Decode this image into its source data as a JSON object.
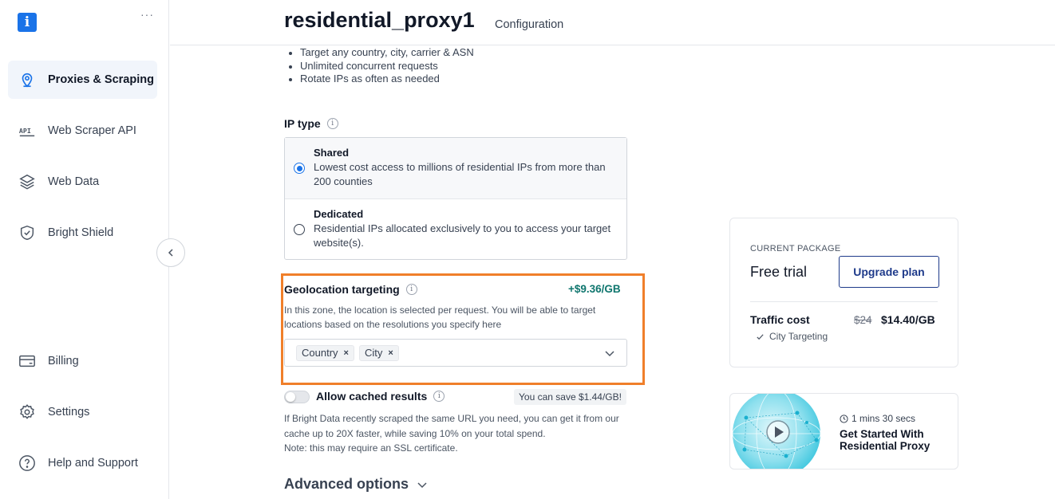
{
  "sidebar": {
    "logo_letter": "i",
    "more": "···",
    "items": [
      {
        "label": "Proxies & Scraping",
        "icon": "location-pin-icon",
        "active": true
      },
      {
        "label": "Web Scraper API",
        "icon": "api-icon",
        "active": false
      },
      {
        "label": "Web Data",
        "icon": "layers-icon",
        "active": false
      },
      {
        "label": "Bright Shield",
        "icon": "shield-icon",
        "active": false
      },
      {
        "label": "Billing",
        "icon": "credit-card-icon",
        "active": false
      },
      {
        "label": "Settings",
        "icon": "gear-icon",
        "active": false
      },
      {
        "label": "Help and Support",
        "icon": "help-circle-icon",
        "active": false
      }
    ]
  },
  "header": {
    "title": "residential_proxy1",
    "subtitle": "Configuration"
  },
  "features": [
    "Target any country, city, carrier & ASN",
    "Unlimited concurrent requests",
    "Rotate IPs as often as needed"
  ],
  "ip_type": {
    "label": "IP type",
    "info": "i",
    "options": [
      {
        "title": "Shared",
        "desc": "Lowest cost access to millions of residential IPs from more than 200 counties",
        "selected": true
      },
      {
        "title": "Dedicated",
        "desc": "Residential IPs allocated exclusively to you to access your target website(s).",
        "selected": false
      }
    ]
  },
  "geo": {
    "label": "Geolocation targeting",
    "info": "i",
    "price": "+$9.36/GB",
    "desc": "In this zone, the location is selected per request. You will be able to target locations based on the resolutions you specify here",
    "chips": [
      "Country",
      "City"
    ],
    "chip_remove": "×",
    "highlight_color": "#f07f2a"
  },
  "cache": {
    "label": "Allow cached results",
    "info": "i",
    "enabled": false,
    "badge": "You can save $1.44/GB!",
    "desc_line1": "If Bright Data recently scraped the same URL you need, you can get it from our cache up to 20X faster, while saving 10% on your total spend.",
    "desc_line2": "Note: this may require an SSL certificate."
  },
  "advanced": {
    "label": "Advanced options"
  },
  "package": {
    "label": "CURRENT PACKAGE",
    "name": "Free trial",
    "upgrade_label": "Upgrade plan",
    "traffic_label": "Traffic cost",
    "old_price": "$24",
    "new_price": "$14.40/GB",
    "targeting": "City Targeting"
  },
  "video": {
    "duration": "1 mins 30 secs",
    "title_line1": "Get Started With",
    "title_line2": "Residential Proxy"
  },
  "colors": {
    "accent": "#1a73e8",
    "brand_navy": "#1e3a8a",
    "price_green": "#0f766e"
  }
}
